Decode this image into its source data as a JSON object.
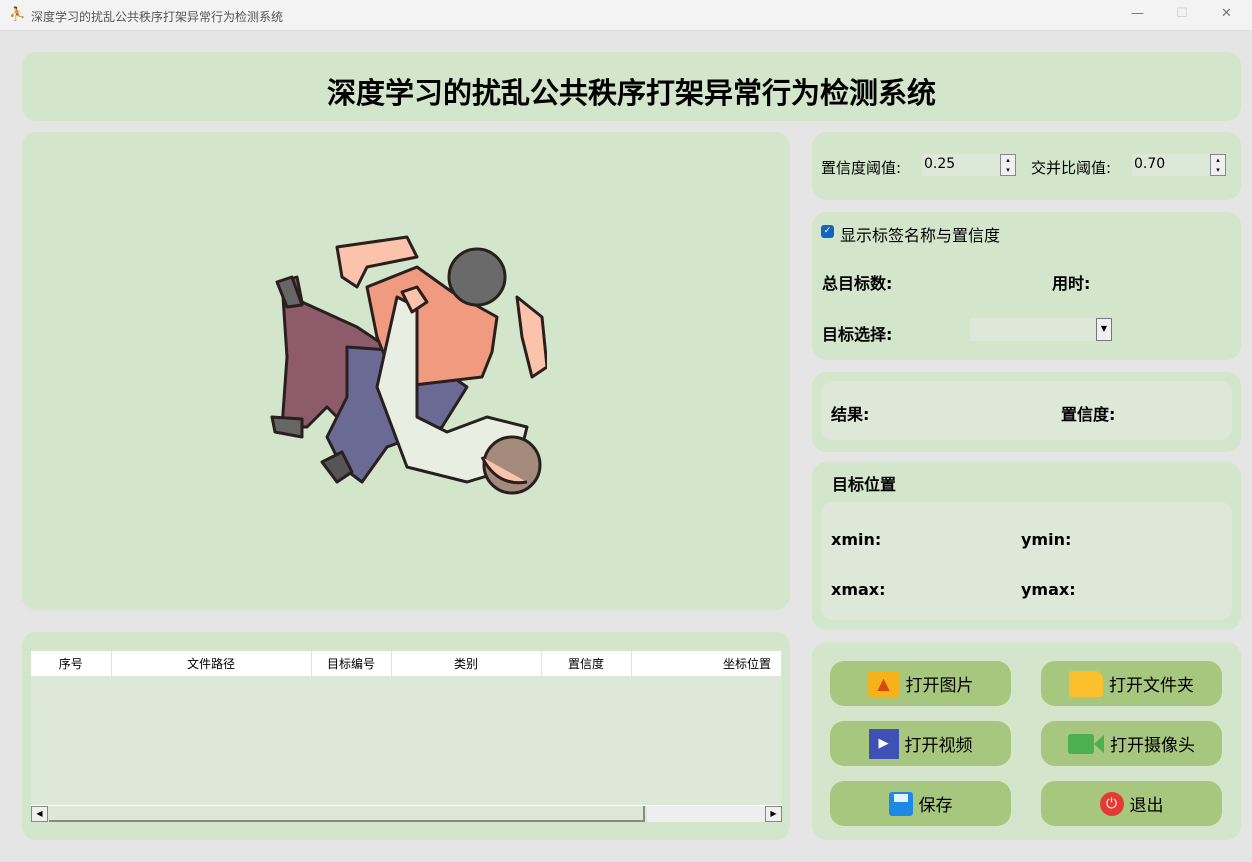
{
  "window": {
    "title": "深度学习的扰乱公共秩序打架异常行为检测系统"
  },
  "header": {
    "title": "深度学习的扰乱公共秩序打架异常行为检测系统"
  },
  "params": {
    "conf_label": "置信度阈值:",
    "conf_value": "0.25",
    "iou_label": "交并比阈值:",
    "iou_value": "0.70"
  },
  "info": {
    "show_label": "显示标签名称与置信度",
    "show_checked": true,
    "total_label": "总目标数:",
    "time_label": "用时:",
    "select_label": "目标选择:"
  },
  "result": {
    "result_label": "结果:",
    "conf_label": "置信度:"
  },
  "position": {
    "title": "目标位置",
    "xmin": "xmin:",
    "ymin": "ymin:",
    "xmax": "xmax:",
    "ymax": "ymax:"
  },
  "table": {
    "columns": [
      "序号",
      "文件路径",
      "目标编号",
      "类别",
      "置信度",
      "坐标位置"
    ]
  },
  "buttons": {
    "open_image": "打开图片",
    "open_folder": "打开文件夹",
    "open_video": "打开视频",
    "open_camera": "打开摄像头",
    "save": "保存",
    "exit": "退出"
  }
}
